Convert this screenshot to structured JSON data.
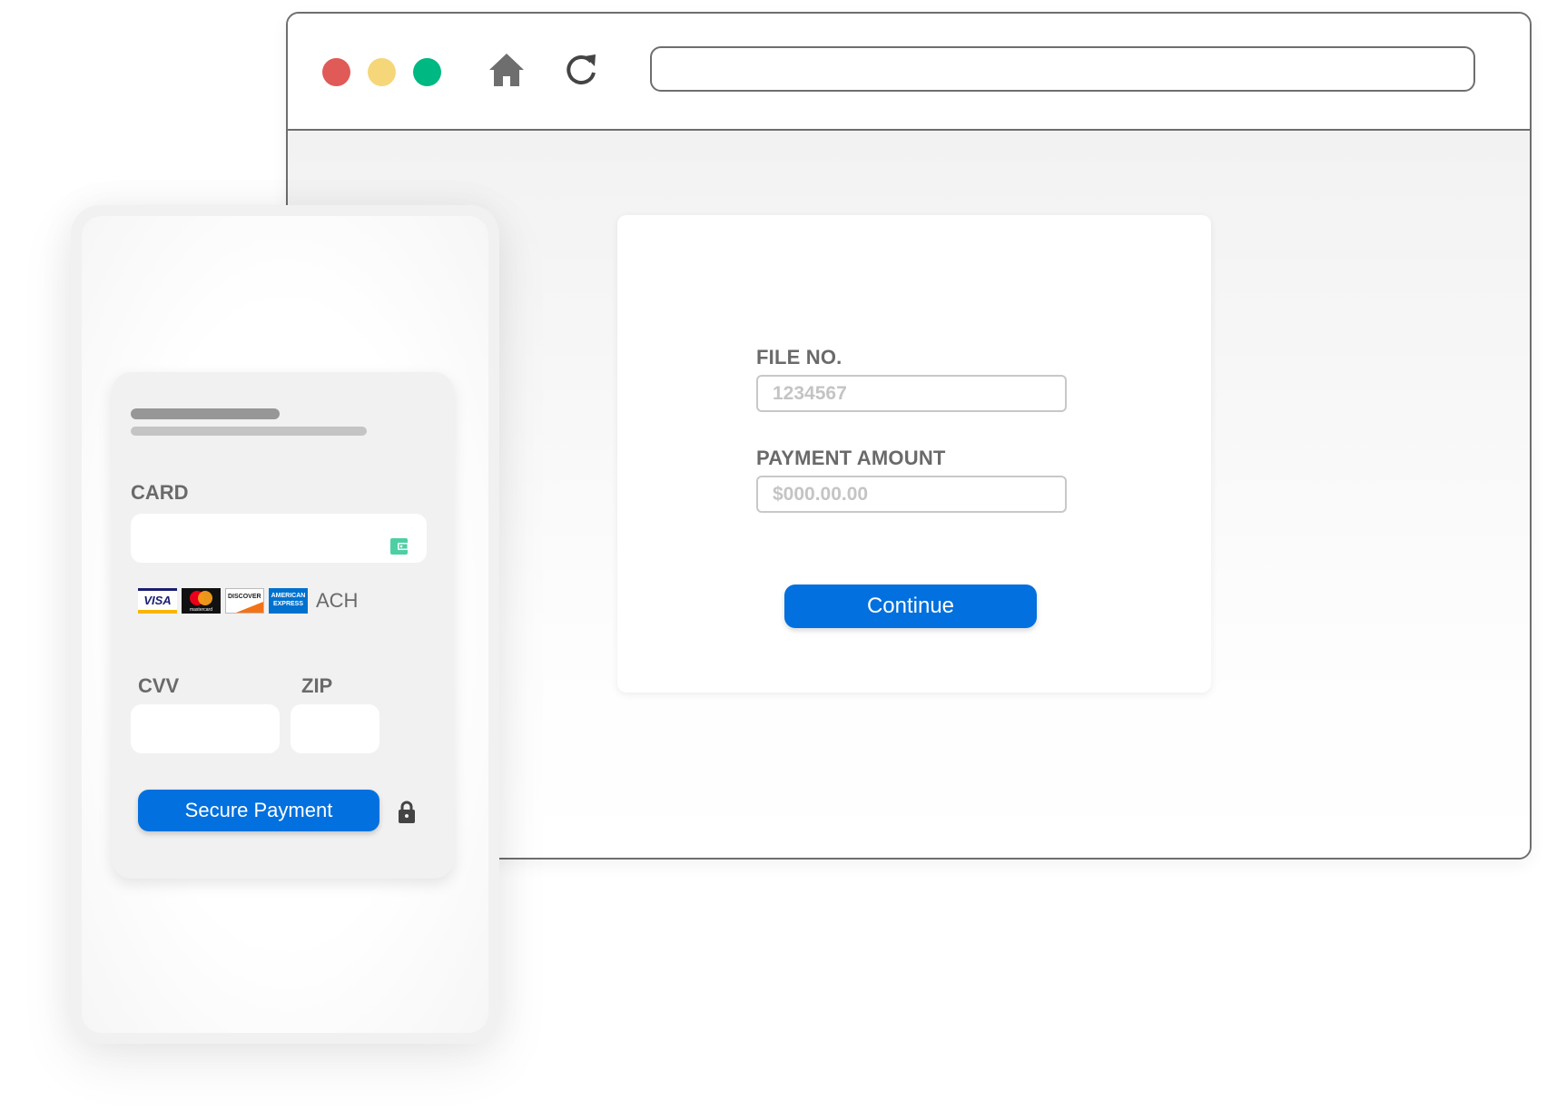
{
  "browser": {
    "window_controls": [
      {
        "name": "close",
        "color": "#e05a57"
      },
      {
        "name": "minimize",
        "color": "#f5d77a"
      },
      {
        "name": "maximize",
        "color": "#00b881"
      }
    ],
    "icons": {
      "home": "home-icon",
      "reload": "reload-icon"
    },
    "url": ""
  },
  "form": {
    "file_no": {
      "label": "FILE NO.",
      "placeholder": "1234567",
      "value": ""
    },
    "payment_amount": {
      "label": "PAYMENT AMOUNT",
      "placeholder": "$000.00.00",
      "value": ""
    },
    "continue_label": "Continue",
    "accent_color": "#0270de"
  },
  "payment_card": {
    "card": {
      "label": "CARD",
      "value": "",
      "icon": "wallet-icon",
      "icon_color": "#4dcfa5"
    },
    "accepted_methods": [
      {
        "name": "visa",
        "text": "VISA"
      },
      {
        "name": "mastercard",
        "text": "mastercard"
      },
      {
        "name": "discover",
        "text": "DISCOVER"
      },
      {
        "name": "amex",
        "text": "AMERICAN EXPRESS"
      },
      {
        "name": "ach",
        "text": "ACH"
      }
    ],
    "cvv": {
      "label": "CVV",
      "value": ""
    },
    "zip": {
      "label": "ZIP",
      "value": ""
    },
    "submit_label": "Secure Payment",
    "lock_icon": "lock-icon"
  }
}
